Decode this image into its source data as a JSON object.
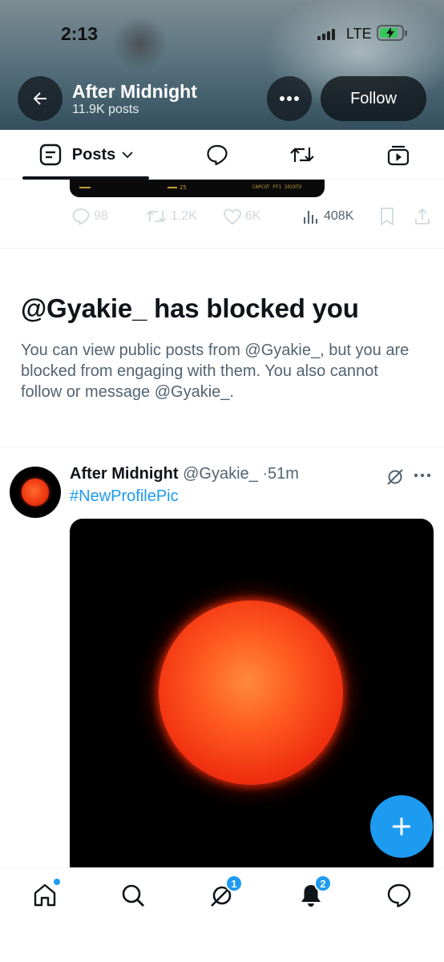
{
  "status_bar": {
    "time": "2:13",
    "network": "LTE"
  },
  "header": {
    "title": "After Midnight",
    "subtitle": "11.9K posts",
    "follow_label": "Follow"
  },
  "tabs": [
    {
      "label": "Posts",
      "icon": "posts-icon",
      "active": true
    },
    {
      "label": "",
      "icon": "reply-icon"
    },
    {
      "label": "",
      "icon": "repost-icon"
    },
    {
      "label": "",
      "icon": "media-icon"
    }
  ],
  "previous_post": {
    "media_text_1": "25",
    "media_text_2": "CAPCUT FF1 202XTV",
    "replies": "98",
    "reposts": "1.2K",
    "likes": "6K",
    "views": "408K"
  },
  "blocked_notice": {
    "title": "@Gyakie_ has blocked you",
    "message": "You can view public posts from @Gyakie_, but you are blocked from engaging with them. You also cannot follow or message @Gyakie_."
  },
  "tweet": {
    "author_name": "After Midnight",
    "handle": "@Gyakie_",
    "separator": "·",
    "time": "51m",
    "text": "#NewProfilePic"
  },
  "bottom_nav": {
    "items": [
      {
        "icon": "home-icon",
        "badge": ""
      },
      {
        "icon": "search-icon",
        "badge": ""
      },
      {
        "icon": "grok-icon",
        "badge": "1"
      },
      {
        "icon": "bell-icon",
        "badge": "2"
      },
      {
        "icon": "messages-icon",
        "badge": ""
      }
    ]
  },
  "colors": {
    "accent": "#1d9bf0",
    "text": "#0f1419",
    "secondary": "#536471",
    "sun": "#ef2f10"
  }
}
